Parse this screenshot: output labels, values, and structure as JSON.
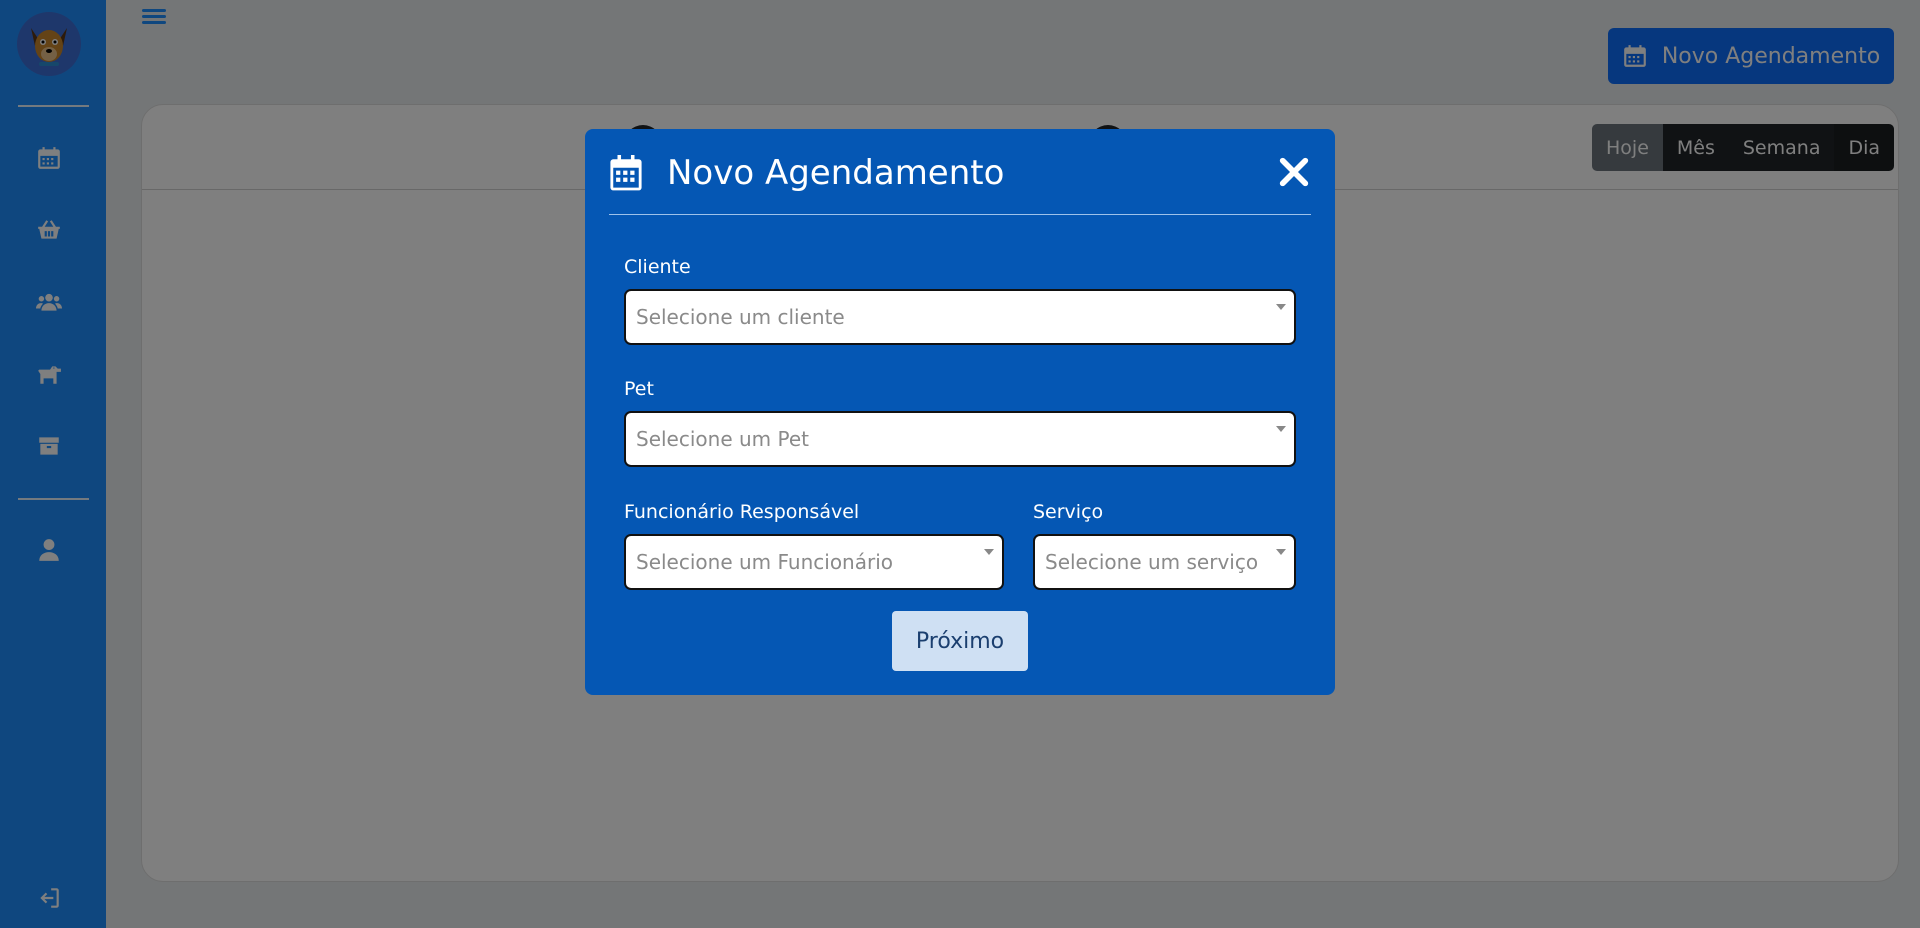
{
  "sidebar": {
    "logo_icon": "dog-mascot-logo",
    "items": [
      {
        "icon": "calendar-icon"
      },
      {
        "icon": "basket-icon"
      },
      {
        "icon": "users-icon"
      },
      {
        "icon": "dog-icon"
      },
      {
        "icon": "box-icon"
      },
      {
        "icon": "user-icon"
      }
    ],
    "logout_icon": "logout-icon"
  },
  "header": {
    "menu_icon": "hamburger-icon",
    "new_appointment_label": "Novo Agendamento"
  },
  "calendar": {
    "views": [
      "Hoje",
      "Mês",
      "Semana",
      "Dia"
    ],
    "active_view": "Dia"
  },
  "modal": {
    "title": "Novo Agendamento",
    "title_icon": "calendar-icon",
    "close_icon": "close-icon",
    "fields": {
      "cliente": {
        "label": "Cliente",
        "placeholder": "Selecione um cliente"
      },
      "pet": {
        "label": "Pet",
        "placeholder": "Selecione um Pet"
      },
      "funcionario": {
        "label": "Funcionário Responsável",
        "placeholder": "Selecione um Funcionário"
      },
      "servico": {
        "label": "Serviço",
        "placeholder": "Selecione um serviço"
      }
    },
    "next_label": "Próximo"
  },
  "colors": {
    "sidebar": "#1f8fff",
    "modal": "#0557b4",
    "primary": "#0d6efd"
  }
}
